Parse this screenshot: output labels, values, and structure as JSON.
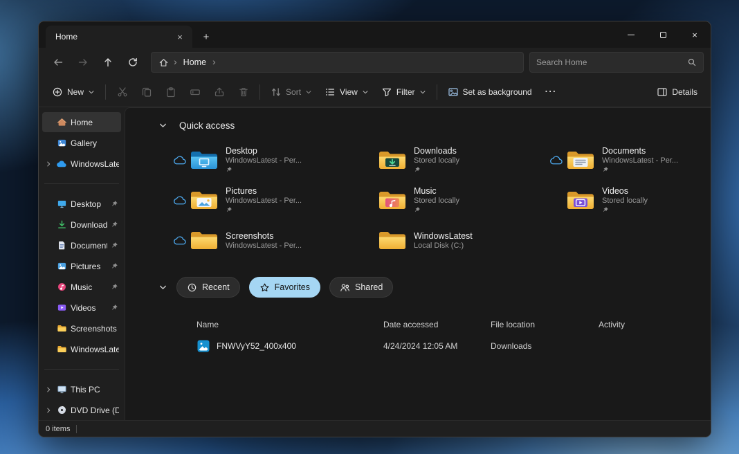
{
  "colors": {
    "accent_pill": "#a5d6f3",
    "folder_yellow": "#f5c043",
    "selection_bg": "#333333",
    "window_bg": "#1f1f1f",
    "content_bg": "#191919"
  },
  "glyphs": {
    "close": "×",
    "tab_close": "×",
    "new_tab": "+",
    "more": "…",
    "breadcrumb_chevron": "›"
  },
  "window": {
    "tab_title": "Home"
  },
  "navigation": {
    "breadcrumb_root": "Home",
    "search_placeholder": "Search Home"
  },
  "toolbar": {
    "new_label": "New",
    "sort_label": "Sort",
    "view_label": "View",
    "filter_label": "Filter",
    "set_as_background_label": "Set as background",
    "details_label": "Details"
  },
  "sidebar": {
    "items": [
      {
        "label": "Home"
      },
      {
        "label": "Gallery"
      },
      {
        "label": "WindowsLatest -"
      },
      {
        "label": "Desktop"
      },
      {
        "label": "Downloads"
      },
      {
        "label": "Documents"
      },
      {
        "label": "Pictures"
      },
      {
        "label": "Music"
      },
      {
        "label": "Videos"
      },
      {
        "label": "Screenshots"
      },
      {
        "label": "WindowsLatest"
      },
      {
        "label": "This PC"
      },
      {
        "label": "DVD Drive (D:) C"
      }
    ]
  },
  "quick_access": {
    "title": "Quick access",
    "items": [
      {
        "name": "Desktop",
        "subtitle": "WindowsLatest - Per..."
      },
      {
        "name": "Downloads",
        "subtitle": "Stored locally"
      },
      {
        "name": "Documents",
        "subtitle": "WindowsLatest - Per..."
      },
      {
        "name": "Pictures",
        "subtitle": "WindowsLatest - Per..."
      },
      {
        "name": "Music",
        "subtitle": "Stored locally"
      },
      {
        "name": "Videos",
        "subtitle": "Stored locally"
      },
      {
        "name": "Screenshots",
        "subtitle": "WindowsLatest - Per..."
      },
      {
        "name": "WindowsLatest",
        "subtitle": "Local Disk (C:)"
      }
    ]
  },
  "section_tabs": {
    "recent": "Recent",
    "favorites": "Favorites",
    "shared": "Shared"
  },
  "files_table": {
    "columns": [
      "Name",
      "Date accessed",
      "File location",
      "Activity"
    ],
    "rows": [
      {
        "name": "FNWVyY52_400x400",
        "date_accessed": "4/24/2024 12:05 AM",
        "file_location": "Downloads",
        "activity": ""
      }
    ]
  },
  "status_bar": {
    "items_count": "0 items"
  }
}
